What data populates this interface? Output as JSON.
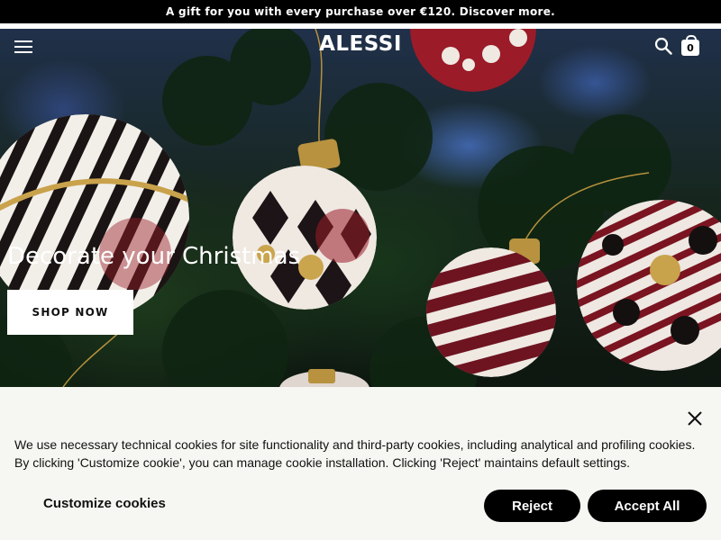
{
  "promo": {
    "text": "A gift for you with every purchase over €120. Discover more."
  },
  "header": {
    "logo": "ALESSI",
    "menu_icon": "hamburger-menu-icon",
    "search_icon": "search-icon",
    "cart_icon": "shopping-bag-icon",
    "cart_count": "0"
  },
  "hero": {
    "title": "Decorate your Christmas",
    "cta_label": "SHOP NOW"
  },
  "cookie_banner": {
    "close_icon": "close-icon",
    "text": "We use necessary technical cookies for site functionality and third-party cookies, including analytical and profiling cookies. By clicking 'Customize cookie', you can manage cookie installation. Clicking 'Reject' maintains default settings.",
    "customize_label": "Customize cookies",
    "reject_label": "Reject",
    "accept_label": "Accept All"
  },
  "colors": {
    "promo_bg": "#000000",
    "banner_bg": "#f6f6f2",
    "button_bg": "#000000",
    "ornament_red": "#7a1420",
    "ornament_white": "#f2efe9"
  }
}
